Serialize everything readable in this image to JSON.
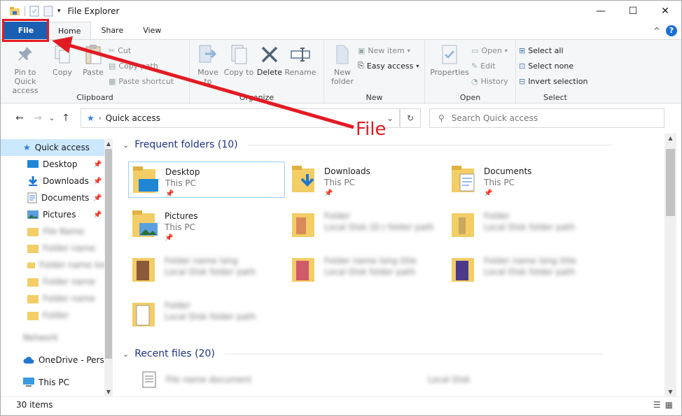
{
  "window": {
    "title": "File Explorer",
    "minimize": "—",
    "maximize": "☐",
    "close": "✕"
  },
  "tabs": {
    "file": "File",
    "home": "Home",
    "share": "Share",
    "view": "View",
    "help": "?",
    "collapse": "^"
  },
  "ribbon": {
    "clipboard": {
      "label": "Clipboard",
      "pin": "Pin to Quick access",
      "copy": "Copy",
      "paste": "Paste",
      "cut": "Cut",
      "copy_path": "Copy path",
      "paste_shortcut": "Paste shortcut"
    },
    "organize": {
      "label": "Organize",
      "move_to": "Move to",
      "copy_to": "Copy to",
      "delete": "Delete",
      "rename": "Rename"
    },
    "new": {
      "label": "New",
      "new_folder": "New folder",
      "new_item": "New item",
      "easy_access": "Easy access"
    },
    "open": {
      "label": "Open",
      "properties": "Properties",
      "open": "Open",
      "edit": "Edit",
      "history": "History"
    },
    "select": {
      "label": "Select",
      "select_all": "Select all",
      "select_none": "Select none",
      "invert": "Invert selection"
    }
  },
  "nav": {
    "address": "Quick access",
    "search_placeholder": "Search Quick access"
  },
  "sidebar": {
    "quick_access": "Quick access",
    "items": [
      "Desktop",
      "Downloads",
      "Documents",
      "Pictures"
    ],
    "blurred": [
      "File Name",
      "Folder name",
      "Folder name long",
      "Folder name",
      "Folder name",
      "Folder"
    ],
    "blurred_device": "Network",
    "onedrive": "OneDrive - Persor",
    "this_pc": "This PC"
  },
  "content": {
    "frequent_header": "Frequent folders (10)",
    "recent_header": "Recent files (20)",
    "folders": [
      {
        "name": "Desktop",
        "sub": "This PC"
      },
      {
        "name": "Downloads",
        "sub": "This PC"
      },
      {
        "name": "Documents",
        "sub": "This PC"
      },
      {
        "name": "Pictures",
        "sub": "This PC"
      }
    ],
    "blurred_folders": [
      {
        "name": "Folder",
        "sub": "Local Disk (D:) folder path"
      },
      {
        "name": "Folder",
        "sub": "Local Disk folder path"
      },
      {
        "name": "Folder name long",
        "sub": "Local Disk folder path"
      },
      {
        "name": "Folder name long title",
        "sub": "Local Disk folder path"
      },
      {
        "name": "Folder name long title",
        "sub": "Local Disk folder path"
      },
      {
        "name": "Folder",
        "sub": "Local Disk folder path"
      }
    ],
    "recent_blurred": [
      "File name document",
      "Local Disk"
    ]
  },
  "status": {
    "count": "30 items"
  },
  "annotation": {
    "label": "File"
  },
  "colors": {
    "accent": "#1a5fb4",
    "annotation": "#e21b23",
    "folder": "#f3cd66",
    "selection": "#cce8ff"
  }
}
